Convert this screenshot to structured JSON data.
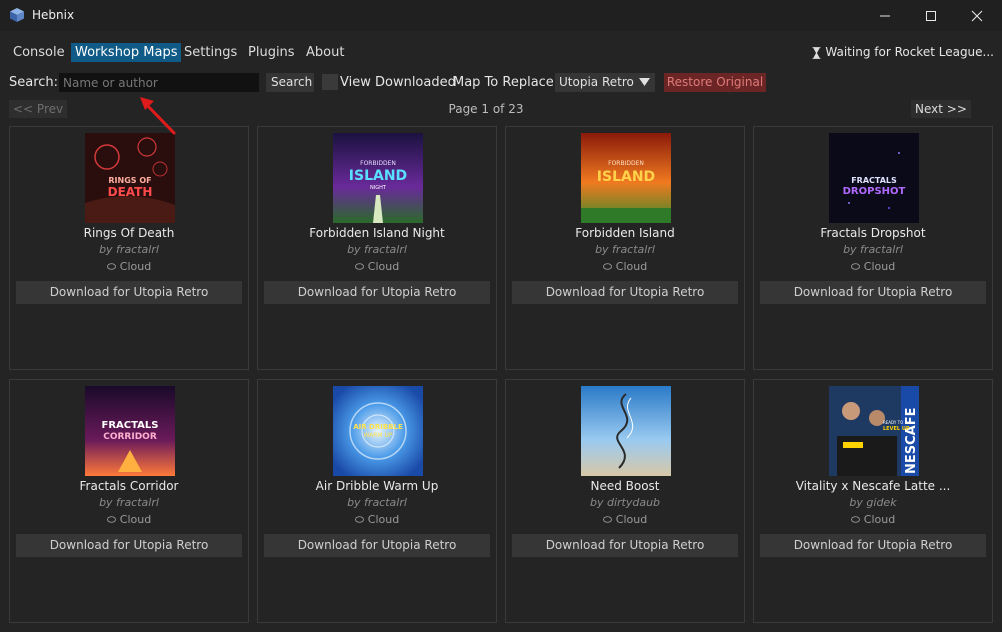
{
  "window": {
    "title": "Hebnix",
    "icon": "cube-app-icon"
  },
  "menu": {
    "items": [
      {
        "label": "Console",
        "active": false
      },
      {
        "label": "Workshop Maps",
        "active": true
      },
      {
        "label": "Settings",
        "active": false
      },
      {
        "label": "Plugins",
        "active": false
      },
      {
        "label": "About",
        "active": false
      }
    ],
    "status": "Waiting for Rocket League...",
    "status_icon": "hourglass-icon"
  },
  "toolbar": {
    "search_label": "Search:",
    "search_placeholder": "Name or author",
    "search_value": "",
    "search_button": "Search",
    "view_downloaded_label": "View Downloaded",
    "view_downloaded_checked": false,
    "map_to_replace_label": "Map To Replace:",
    "map_to_replace_value": "Utopia Retro",
    "restore_button": "Restore Original"
  },
  "pager": {
    "prev_label": "<< Prev",
    "next_label": "Next >>",
    "page_text": "Page 1 of 23"
  },
  "maps": [
    {
      "title": "Rings Of Death",
      "author": "by fractalrl",
      "source": "Cloud",
      "button": "Download for Utopia Retro"
    },
    {
      "title": "Forbidden Island Night",
      "author": "by fractalrl",
      "source": "Cloud",
      "button": "Download for Utopia Retro"
    },
    {
      "title": "Forbidden Island",
      "author": "by fractalrl",
      "source": "Cloud",
      "button": "Download for Utopia Retro"
    },
    {
      "title": "Fractals Dropshot",
      "author": "by fractalrl",
      "source": "Cloud",
      "button": "Download for Utopia Retro"
    },
    {
      "title": "Fractals Corridor",
      "author": "by fractalrl",
      "source": "Cloud",
      "button": "Download for Utopia Retro"
    },
    {
      "title": "Air Dribble Warm Up",
      "author": "by fractalrl",
      "source": "Cloud",
      "button": "Download for Utopia Retro"
    },
    {
      "title": "Need Boost",
      "author": "by dirtydaub",
      "source": "Cloud",
      "button": "Download for Utopia Retro"
    },
    {
      "title": "Vitality x Nescafe Latte ...",
      "author": "by gidek",
      "source": "Cloud",
      "button": "Download for Utopia Retro"
    }
  ],
  "thumb_text": {
    "t0": [
      "RINGS OF",
      "DEATH"
    ],
    "t1": [
      "FORBIDDEN",
      "ISLAND",
      "NIGHT"
    ],
    "t2": [
      "FORBIDDEN",
      "ISLAND"
    ],
    "t3": [
      "FRACTALS",
      "DROPSHOT"
    ],
    "t4": [
      "FRACTALS",
      "CORRIDOR"
    ],
    "t5": [
      "AIR DRIBBLE",
      "WARM UP"
    ],
    "t7": [
      "NESCAFE",
      "READY TO",
      "LEVEL UP"
    ]
  },
  "colors": {
    "accent": "#0f5a86",
    "restore_bg": "#6b2525",
    "restore_text": "#e07a7a",
    "annotation": "#e01b1b"
  }
}
